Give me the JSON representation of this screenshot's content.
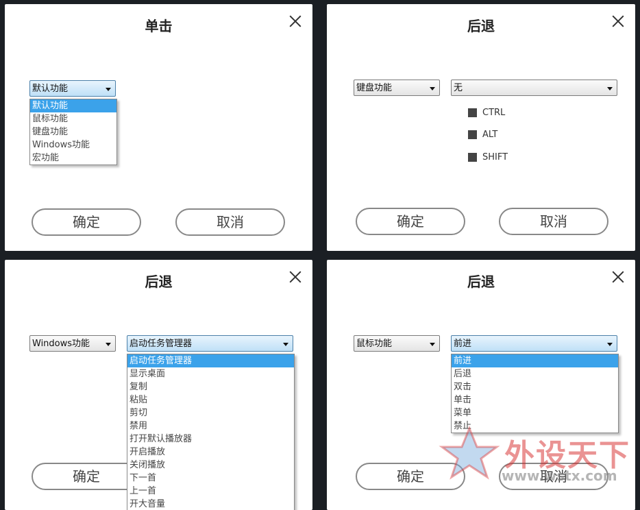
{
  "panels": {
    "p1": {
      "title": "单击",
      "select": "默认功能",
      "options": [
        "默认功能",
        "鼠标功能",
        "键盘功能",
        "Windows功能",
        "宏功能"
      ],
      "ok": "确定",
      "cancel": "取消"
    },
    "p2": {
      "title": "后退",
      "select1": "键盘功能",
      "select2": "无",
      "modifiers": [
        "CTRL",
        "ALT",
        "SHIFT"
      ],
      "ok": "确定",
      "cancel": "取消"
    },
    "p3": {
      "title": "后退",
      "select1": "Windows功能",
      "select2": "启动任务管理器",
      "options": [
        "启动任务管理器",
        "显示桌面",
        "复制",
        "粘贴",
        "剪切",
        "禁用",
        "打开默认播放器",
        "开启播放",
        "关闭播放",
        "下一首",
        "上一首",
        "开大音量"
      ],
      "ok": "确定"
    },
    "p4": {
      "title": "后退",
      "select1": "鼠标功能",
      "select2": "前进",
      "options": [
        "前进",
        "后退",
        "双击",
        "单击",
        "菜单",
        "禁止"
      ],
      "ok": "确定",
      "cancel": "取消"
    }
  },
  "watermark": {
    "text": "外设天下",
    "url": "www.wstx.com"
  },
  "colors": {
    "selected": "#3ba2ea",
    "panel": "#ffffff",
    "background": "#1b1f24"
  },
  "icons": {
    "close": "close-icon",
    "dropdown": "chevron-down-icon",
    "checkbox": "checkbox-icon"
  }
}
